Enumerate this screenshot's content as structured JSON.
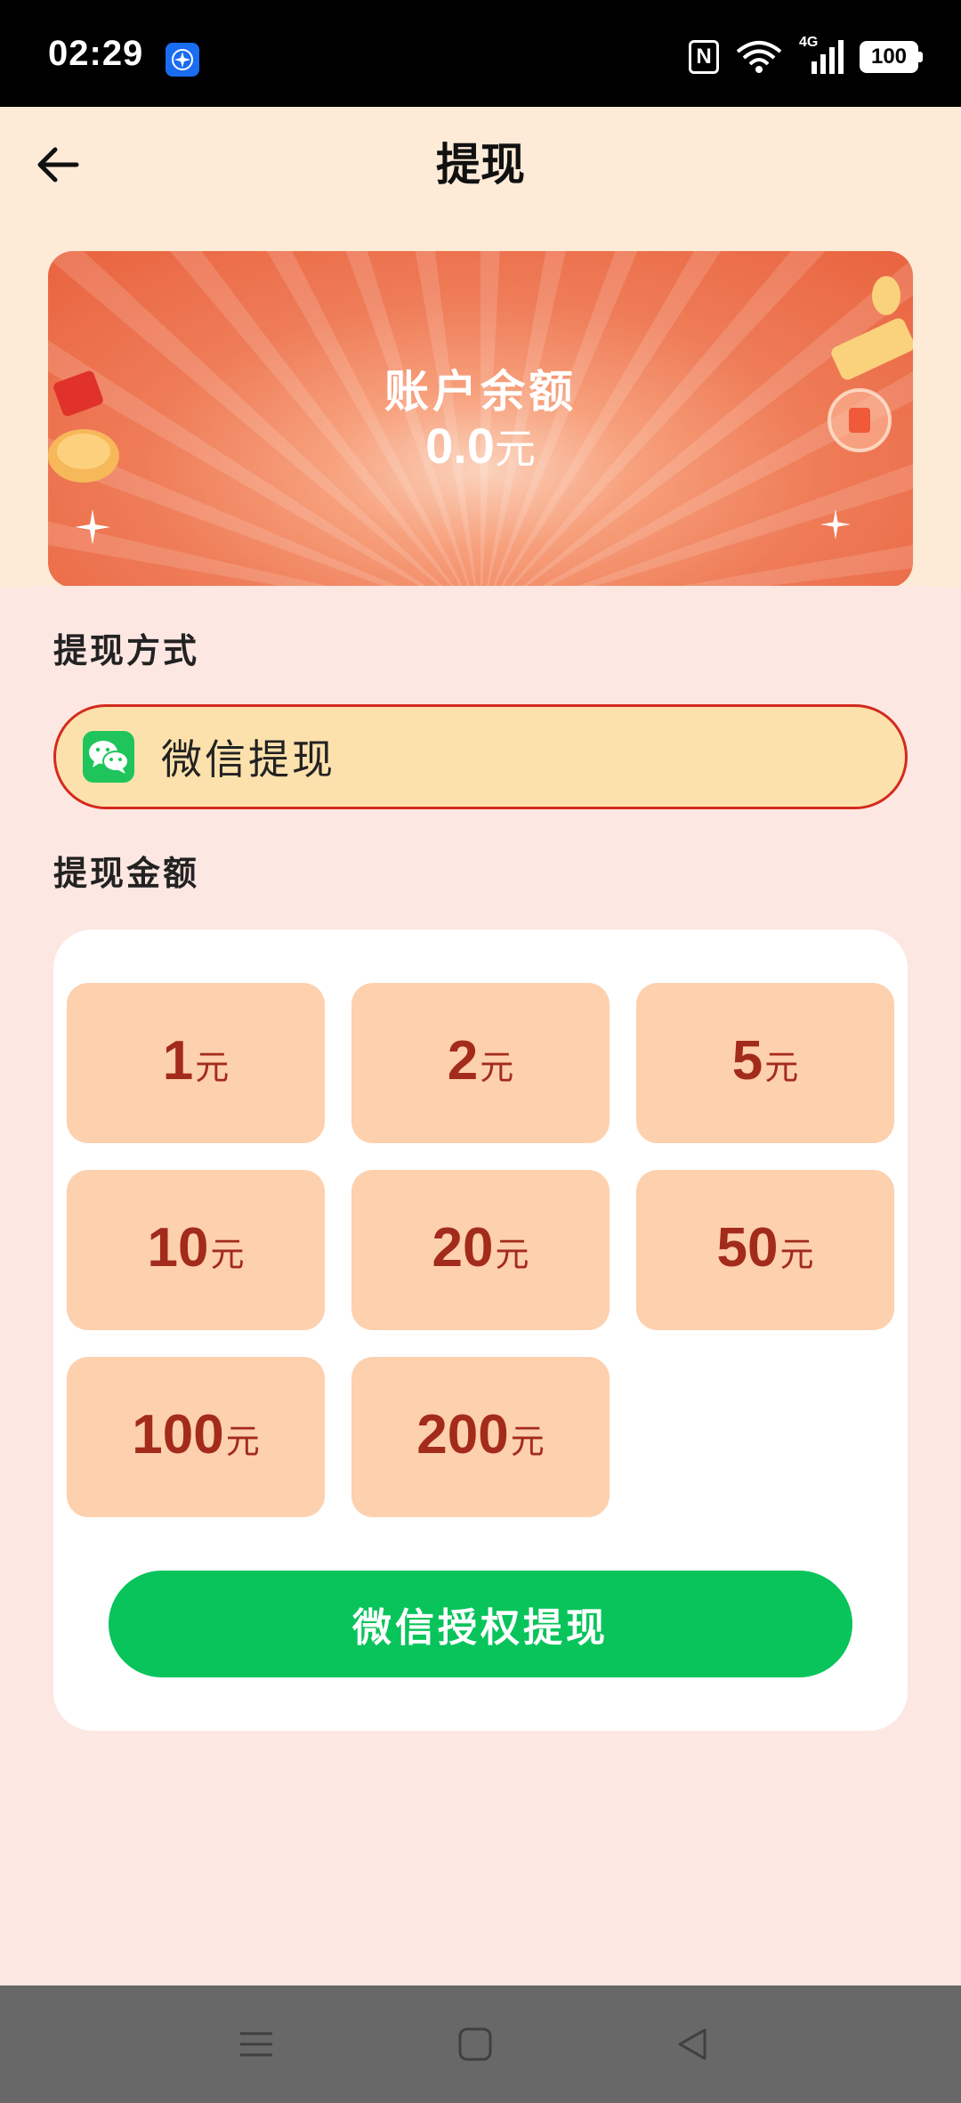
{
  "status_bar": {
    "time": "02:29",
    "network": "4G",
    "battery": "100",
    "icons": [
      "app-notification-icon",
      "nfc-icon",
      "wifi-icon",
      "signal-icon",
      "battery-icon"
    ]
  },
  "header": {
    "title": "提现",
    "back_icon": "arrow-left-icon"
  },
  "balance_card": {
    "label": "账户余额",
    "amount": "0.0",
    "unit": "元",
    "accent": "#ee6f4b"
  },
  "withdraw_method": {
    "section_label": "提现方式",
    "option_label": "微信提现",
    "selected": true,
    "icon": "wechat-icon",
    "border_color": "#d42a1e",
    "fill_color": "#fde1ad"
  },
  "withdraw_amount": {
    "section_label": "提现金额",
    "options": [
      {
        "value": "1",
        "unit": "元"
      },
      {
        "value": "2",
        "unit": "元"
      },
      {
        "value": "5",
        "unit": "元"
      },
      {
        "value": "10",
        "unit": "元"
      },
      {
        "value": "20",
        "unit": "元"
      },
      {
        "value": "50",
        "unit": "元"
      },
      {
        "value": "100",
        "unit": "元"
      },
      {
        "value": "200",
        "unit": "元"
      }
    ],
    "option_color": "#fdd0ae",
    "text_color": "#a32b1b"
  },
  "action": {
    "button_label": "微信授权提现",
    "color": "#08c45b"
  },
  "system_nav": {
    "icons": [
      "menu-icon",
      "home-icon",
      "back-triangle-icon"
    ]
  }
}
